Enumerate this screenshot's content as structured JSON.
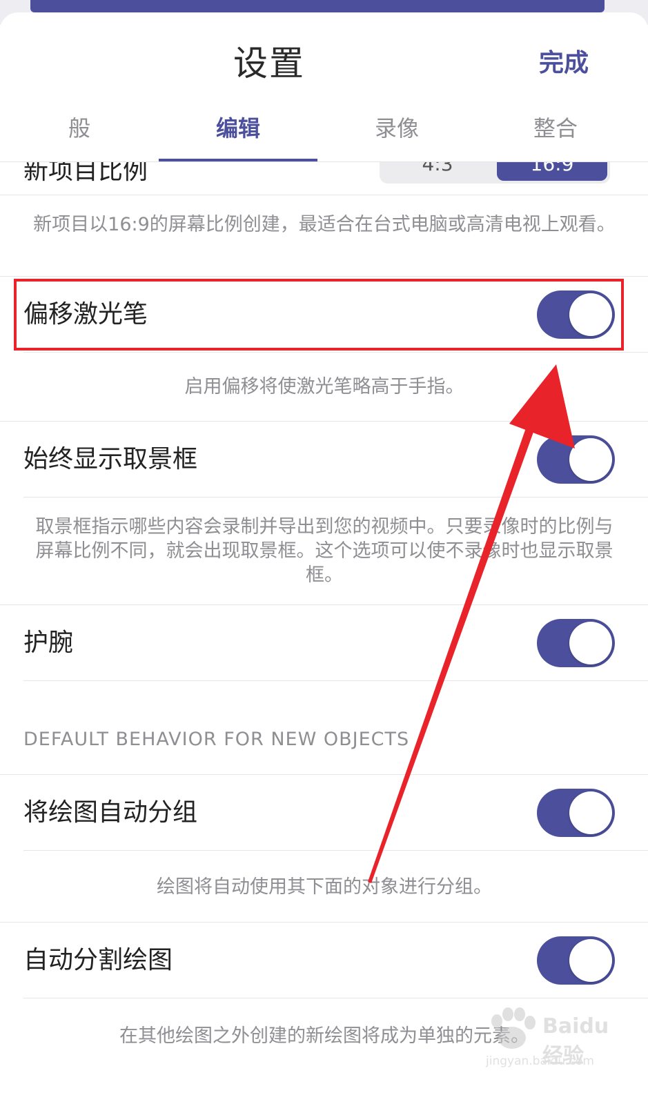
{
  "nav": {
    "title": "设置",
    "done_label": "完成"
  },
  "tabs": [
    {
      "label": "般",
      "active": false
    },
    {
      "label": "编辑",
      "active": true
    },
    {
      "label": "录像",
      "active": false
    },
    {
      "label": "整合",
      "active": false
    }
  ],
  "aspect": {
    "label": "新项目比例",
    "options": [
      "4:3",
      "16:9"
    ],
    "selected": "16:9"
  },
  "descriptions": {
    "aspect": "新项目以16:9的屏幕比例创建，最适合在台式电脑或高清电视上观看。",
    "offset": "启用偏移将使激光笔略高于手指。",
    "frame": "取景框指示哪些内容会录制并导出到您的视频中。只要录像时的比例与屏幕比例不同，就会出现取景框。这个选项可以使不录像时也显示取景框。",
    "group": "绘图将自动使用其下面的对象进行分组。",
    "split": "在其他绘图之外创建的新绘图将成为单独的元素。"
  },
  "settings": [
    {
      "label": "偏移激光笔",
      "on": true
    },
    {
      "label": "始终显示取景框",
      "on": true
    },
    {
      "label": "护腕",
      "on": true
    },
    {
      "label": "将绘图自动分组",
      "on": true
    },
    {
      "label": "自动分割绘图",
      "on": true
    }
  ],
  "section_header": "DEFAULT BEHAVIOR FOR NEW OBJECTS",
  "watermark": {
    "text": "Baidu 经验",
    "url": "jingyan.baidu.com"
  },
  "colors": {
    "accent": "#4b4f9c",
    "annotation": "#e8232a",
    "secondary_text": "#8e8e93"
  }
}
